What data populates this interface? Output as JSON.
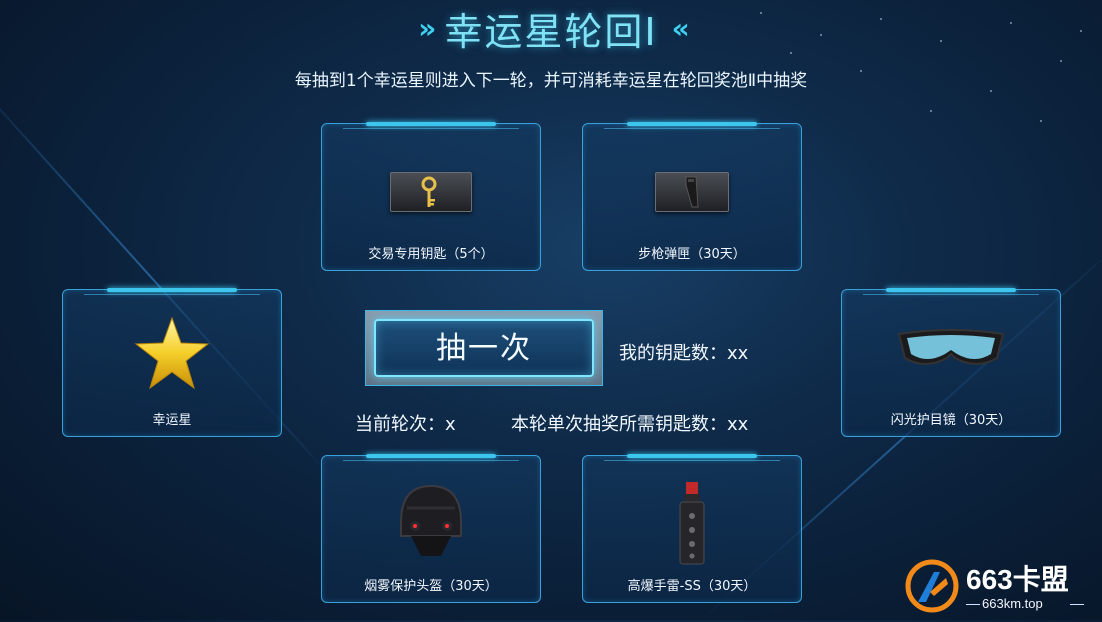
{
  "header": {
    "title": "幸运星轮回Ⅰ",
    "chevron_left": "»",
    "chevron_right": "«",
    "subtitle": "每抽到1个幸运星则进入下一轮，并可消耗幸运星在轮回奖池Ⅱ中抽奖"
  },
  "prizes": [
    {
      "label": "交易专用钥匙（5个）",
      "icon": "key-icon"
    },
    {
      "label": "步枪弹匣（30天）",
      "icon": "magazine-icon"
    },
    {
      "label": "幸运星",
      "icon": "star-icon"
    },
    {
      "label": "闪光护目镜（30天）",
      "icon": "goggles-icon"
    },
    {
      "label": "烟雾保护头盔（30天）",
      "icon": "helmet-icon"
    },
    {
      "label": "高爆手雷-SS（30天）",
      "icon": "grenade-icon"
    }
  ],
  "draw": {
    "button_label": "抽一次",
    "key_count": "我的钥匙数：xx",
    "current_round": "当前轮次：x",
    "keys_required": "本轮单次抽奖所需钥匙数：xx"
  },
  "watermark": {
    "brand": "663卡盟",
    "domain": "663km.top"
  },
  "colors": {
    "accent": "#7fe2f5",
    "card_border": "#3aa0d8",
    "background": "#0f2b4a"
  }
}
